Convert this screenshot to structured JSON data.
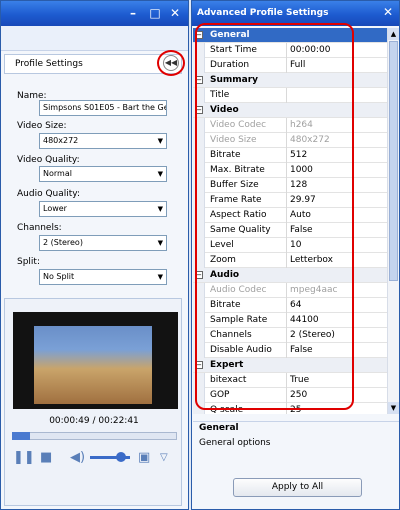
{
  "left_window": {
    "panel_title": "Profile Settings",
    "fields": [
      {
        "label": "Name:",
        "value": "Simpsons S01E05 - Bart the Ge"
      },
      {
        "label": "Video Size:",
        "value": "480x272"
      },
      {
        "label": "Video Quality:",
        "value": "Normal"
      },
      {
        "label": "Audio Quality:",
        "value": "Lower"
      },
      {
        "label": "Channels:",
        "value": "2 (Stereo)"
      },
      {
        "label": "Split:",
        "value": "No Split"
      }
    ],
    "player": {
      "time": "00:00:49 / 00:22:41",
      "progress": 0.036
    }
  },
  "right_window": {
    "title": "Advanced Profile Settings",
    "rows": [
      {
        "type": "cat",
        "name": "General",
        "selected": true
      },
      {
        "type": "prop",
        "name": "Start Time",
        "value": "00:00:00"
      },
      {
        "type": "prop",
        "name": "Duration",
        "value": "Full"
      },
      {
        "type": "cat",
        "name": "Summary"
      },
      {
        "type": "prop",
        "name": "Title",
        "value": ""
      },
      {
        "type": "cat",
        "name": "Video"
      },
      {
        "type": "prop",
        "name": "Video Codec",
        "value": "h264",
        "disabled": true
      },
      {
        "type": "prop",
        "name": "Video Size",
        "value": "480x272",
        "disabled": true
      },
      {
        "type": "prop",
        "name": "Bitrate",
        "value": "512"
      },
      {
        "type": "prop",
        "name": "Max. Bitrate",
        "value": "1000"
      },
      {
        "type": "prop",
        "name": "Buffer Size",
        "value": "128"
      },
      {
        "type": "prop",
        "name": "Frame Rate",
        "value": "29.97"
      },
      {
        "type": "prop",
        "name": "Aspect Ratio",
        "value": "Auto"
      },
      {
        "type": "prop",
        "name": "Same Quality",
        "value": "False"
      },
      {
        "type": "prop",
        "name": "Level",
        "value": "10"
      },
      {
        "type": "prop",
        "name": "Zoom",
        "value": "Letterbox"
      },
      {
        "type": "cat",
        "name": "Audio"
      },
      {
        "type": "prop",
        "name": "Audio Codec",
        "value": "mpeg4aac",
        "disabled": true
      },
      {
        "type": "prop",
        "name": "Bitrate",
        "value": "64"
      },
      {
        "type": "prop",
        "name": "Sample Rate",
        "value": "44100"
      },
      {
        "type": "prop",
        "name": "Channels",
        "value": "2 (Stereo)"
      },
      {
        "type": "prop",
        "name": "Disable Audio",
        "value": "False"
      },
      {
        "type": "cat",
        "name": "Expert"
      },
      {
        "type": "prop",
        "name": "bitexact",
        "value": "True"
      },
      {
        "type": "prop",
        "name": "GOP",
        "value": "250"
      },
      {
        "type": "prop",
        "name": "Q scale",
        "value": "25"
      }
    ],
    "description": {
      "title": "General",
      "text": "General options"
    },
    "apply_label": "Apply to All"
  },
  "colors": {
    "titlebar": "#1d5bd0",
    "highlight": "#e00000",
    "selection": "#316ac5"
  }
}
